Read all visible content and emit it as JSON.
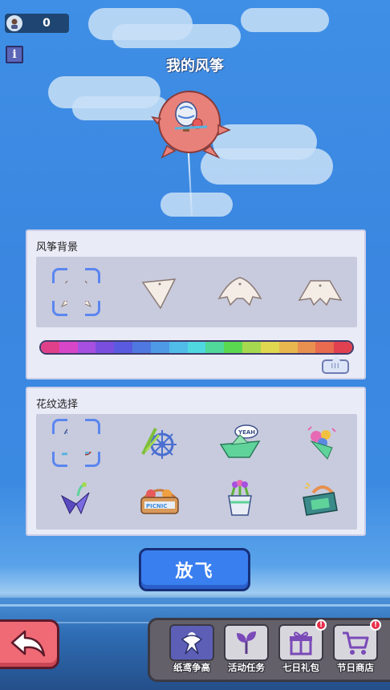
{
  "header": {
    "score": "0",
    "info_label": "i",
    "title": "我的风筝"
  },
  "kite_background": {
    "title": "风筝背景",
    "selected_index": 0,
    "shapes": [
      "round-kite",
      "diamond-kite",
      "bat-kite",
      "trapezoid-kite"
    ],
    "colors": [
      "#e0408a",
      "#d846c8",
      "#a64fe0",
      "#7a4fe0",
      "#5a5ae0",
      "#4f78e0",
      "#4f9ae6",
      "#4fbde8",
      "#4fd8e0",
      "#4fd89a",
      "#5ad84f",
      "#a6d84f",
      "#e0d84f",
      "#e8b84f",
      "#e8904f",
      "#e86a4f",
      "#e04050"
    ],
    "slider_value": 0.94,
    "slider_label": "III"
  },
  "pattern": {
    "title": "花纹选择",
    "selected_index": 0,
    "items": [
      "hot-air-balloon-icon",
      "ship-wheel-icon",
      "paper-boat-icon",
      "flower-bouquet-icon",
      "paper-crane-icon",
      "picnic-basket-icon",
      "flower-pot-icon",
      "radio-icon"
    ]
  },
  "actions": {
    "fly_label": "放飞"
  },
  "bottom_nav": {
    "tabs": [
      {
        "label": "纸鸢争高",
        "icon": "kite-icon",
        "active": true,
        "badge": ""
      },
      {
        "label": "活动任务",
        "icon": "sprout-icon",
        "active": false,
        "badge": ""
      },
      {
        "label": "七日礼包",
        "icon": "gift-icon",
        "active": false,
        "badge": "!"
      },
      {
        "label": "节日商店",
        "icon": "cart-icon",
        "active": false,
        "badge": "!"
      }
    ]
  },
  "colors": {
    "sky": "#3f8fe6",
    "panel": "#e9ebf7",
    "fly_button": "#3a7ff0",
    "back_button": "#f06a76",
    "kite_body": "#e8817a"
  }
}
